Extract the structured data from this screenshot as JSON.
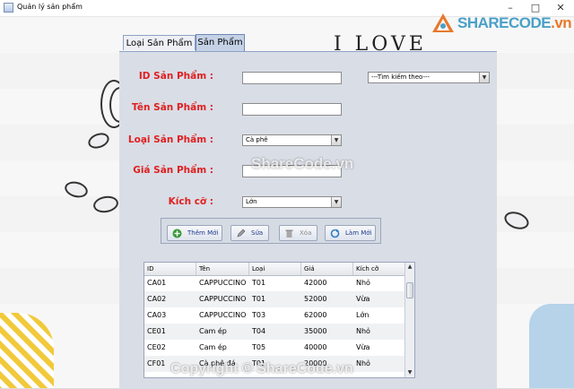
{
  "window": {
    "title": "Quản lý sản phẩm",
    "controls": [
      "minimize",
      "maximize",
      "close"
    ]
  },
  "watermark": {
    "logo_left": "SHARECODE",
    "logo_right": ".vn",
    "center": "ShareCode.vn",
    "bottom": "Copyright © ShareCode.vn"
  },
  "background": {
    "wall_text": "I LOVE"
  },
  "tabs": [
    {
      "label": "Loại Sản Phẩm",
      "active": false
    },
    {
      "label": "Sản Phẩm",
      "active": true
    }
  ],
  "form": {
    "id_label": "ID Sản Phẩm :",
    "name_label": "Tên Sản Phẩm :",
    "type_label": "Loại Sản Phẩm :",
    "price_label": "Giá Sản Phẩm :",
    "size_label": "Kích cỡ :",
    "id_value": "",
    "name_value": "",
    "price_value": "",
    "type_selected": "Cà phê",
    "size_selected": "Lớn",
    "search_selected": "---Tìm kiếm theo---"
  },
  "buttons": {
    "add": "Thêm Mới",
    "edit": "Sửa",
    "delete": "Xóa",
    "refresh": "Làm Mới"
  },
  "colors": {
    "label_red": "#e02020",
    "button_text": "#1f3a8a",
    "panel": "#d9dde6",
    "tab_active": "#c5d2e6"
  },
  "table": {
    "columns": [
      "ID",
      "Tên",
      "Loại",
      "Giá",
      "Kích cỡ"
    ],
    "rows": [
      [
        "CA01",
        "CAPPUCCINO",
        "T01",
        "42000",
        "Nhỏ"
      ],
      [
        "CA02",
        "CAPPUCCINO",
        "T01",
        "52000",
        "Vừa"
      ],
      [
        "CA03",
        "CAPPUCCINO",
        "T03",
        "62000",
        "Lớn"
      ],
      [
        "CE01",
        "Cam ép",
        "T04",
        "35000",
        "Nhỏ"
      ],
      [
        "CE02",
        "Cam ép",
        "T05",
        "40000",
        "Vừa"
      ],
      [
        "CF01",
        "Cà phê đá",
        "T01",
        "20000",
        "Nhỏ"
      ]
    ]
  }
}
